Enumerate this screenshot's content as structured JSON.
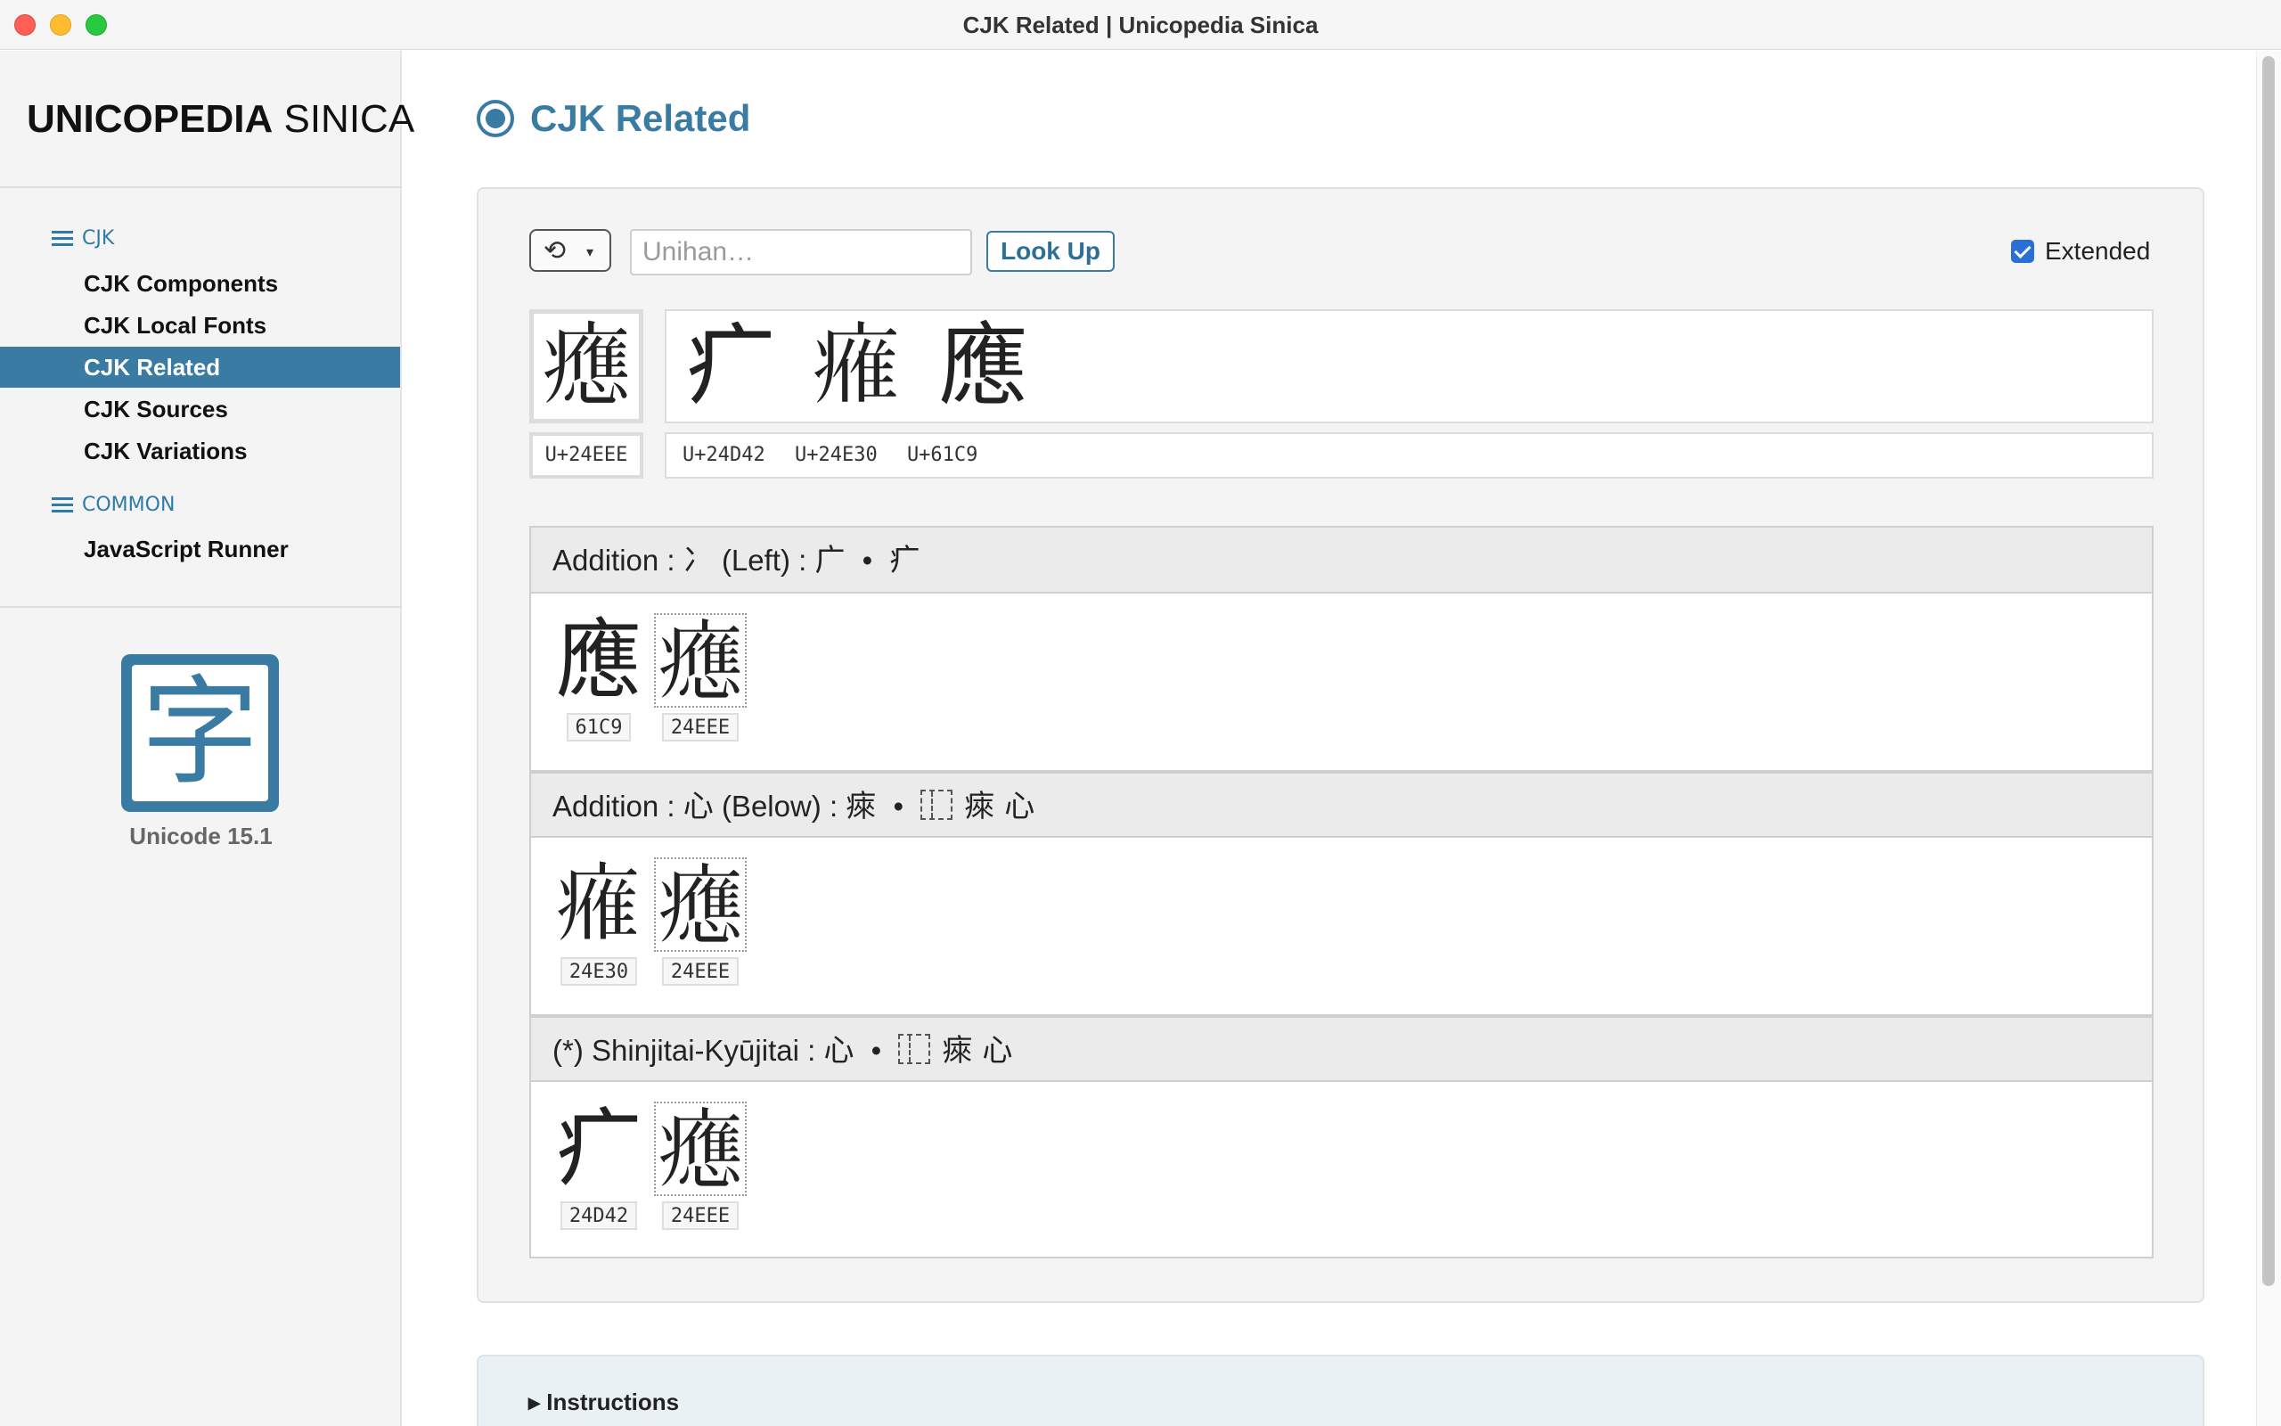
{
  "window": {
    "title": "CJK Related | Unicopedia Sinica"
  },
  "sidebar": {
    "brand_bold": "UNICOPEDIA",
    "brand_light": "SINICA",
    "sections": [
      {
        "label": "CJK",
        "items": [
          "CJK Components",
          "CJK Local Fonts",
          "CJK Related",
          "CJK Sources",
          "CJK Variations"
        ]
      },
      {
        "label": "COMMON",
        "items": [
          "JavaScript Runner"
        ]
      }
    ],
    "active_item": "CJK Related",
    "logo_char": "字",
    "version": "Unicode 15.1"
  },
  "main": {
    "title": "CJK Related",
    "search": {
      "placeholder": "Unihan…",
      "value": "",
      "lookup_label": "Look Up",
      "extended_label": "Extended",
      "extended_checked": true,
      "history_icon": "clock-history-icon"
    },
    "current": {
      "char": "𤻮",
      "code": "U+24EEE"
    },
    "related": {
      "chars": [
        "疒",
        "𤸰",
        "應"
      ],
      "codes": [
        "U+24D42",
        "U+24E30",
        "U+61C9"
      ]
    },
    "groups": [
      {
        "head_label": "Addition :",
        "head_component": "冫",
        "head_position": "(Left) :",
        "head_from": "广",
        "head_dot": "•",
        "head_to": "疒",
        "head_ids": "",
        "glyphs": [
          {
            "char": "應",
            "code": "61C9"
          },
          {
            "char": "𤻮",
            "code": "24EEE"
          }
        ]
      },
      {
        "head_label": "Addition :",
        "head_component": "心",
        "head_position": "(Below) :",
        "head_from": "㾢",
        "head_dot": "•",
        "head_to": "㾢 心",
        "head_ids": "⿱",
        "glyphs": [
          {
            "char": "𤸰",
            "code": "24E30"
          },
          {
            "char": "𤻮",
            "code": "24EEE"
          }
        ]
      },
      {
        "head_label": "(*)  Shinjitai-Kyūjitai :",
        "head_component": "心",
        "head_position": "",
        "head_from": "",
        "head_dot": "•",
        "head_to": "㾢 心",
        "head_ids": "⿱",
        "glyphs": [
          {
            "char": "疒",
            "code": "24D42"
          },
          {
            "char": "𤻮",
            "code": "24EEE"
          }
        ]
      }
    ],
    "instructions_label": "Instructions"
  }
}
